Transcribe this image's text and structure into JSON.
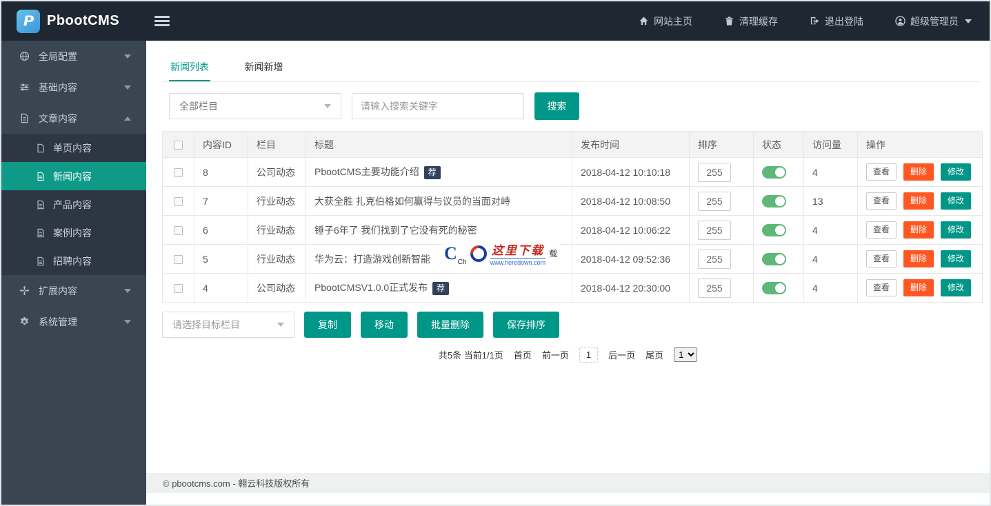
{
  "topbar": {
    "brand": "PbootCMS",
    "logo_letter": "P",
    "nav": [
      {
        "label": "网站主页",
        "icon": "home-icon"
      },
      {
        "label": "清理缓存",
        "icon": "trash-icon"
      },
      {
        "label": "退出登陆",
        "icon": "logout-icon"
      },
      {
        "label": "超级管理员",
        "icon": "user-icon"
      }
    ]
  },
  "sidebar": {
    "items": [
      {
        "label": "全局配置",
        "icon": "globe-icon",
        "state": "collapsed"
      },
      {
        "label": "基础内容",
        "icon": "sliders-icon",
        "state": "collapsed"
      },
      {
        "label": "文章内容",
        "icon": "file-text-icon",
        "state": "expanded",
        "children": [
          {
            "label": "单页内容",
            "active": false
          },
          {
            "label": "新闻内容",
            "active": true
          },
          {
            "label": "产品内容",
            "active": false
          },
          {
            "label": "案例内容",
            "active": false
          },
          {
            "label": "招聘内容",
            "active": false
          }
        ]
      },
      {
        "label": "扩展内容",
        "icon": "expand-icon",
        "state": "collapsed"
      },
      {
        "label": "系统管理",
        "icon": "gear-icon",
        "state": "collapsed"
      }
    ]
  },
  "tabs": [
    {
      "label": "新闻列表",
      "active": true
    },
    {
      "label": "新闻新增",
      "active": false
    }
  ],
  "filter": {
    "category_select": "全部栏目",
    "search_placeholder": "请输入搜索关键字",
    "search_button": "搜索"
  },
  "table": {
    "headers": [
      "内容ID",
      "栏目",
      "标题",
      "发布时间",
      "排序",
      "状态",
      "访问量",
      "操作"
    ],
    "badge": "荐",
    "actions": {
      "view": "查看",
      "delete": "删除",
      "edit": "修改"
    },
    "rows": [
      {
        "id": "8",
        "category": "公司动态",
        "title": "PbootCMS主要功能介绍",
        "recommended": true,
        "date": "2018-04-12 10:10:18",
        "sort": "255",
        "status": "on",
        "visits": "4"
      },
      {
        "id": "7",
        "category": "行业动态",
        "title": "大获全胜 扎克伯格如何赢得与议员的当面对峙",
        "recommended": false,
        "date": "2018-04-12 10:08:50",
        "sort": "255",
        "status": "on",
        "visits": "13"
      },
      {
        "id": "6",
        "category": "行业动态",
        "title": "锤子6年了 我们找到了它没有死的秘密",
        "recommended": false,
        "date": "2018-04-12 10:06:22",
        "sort": "255",
        "status": "on",
        "visits": "4"
      },
      {
        "id": "5",
        "category": "行业动态",
        "title": "华为云：打造游戏创新智能",
        "recommended": false,
        "date": "2018-04-12 09:52:36",
        "sort": "255",
        "status": "on",
        "visits": "4"
      },
      {
        "id": "4",
        "category": "公司动态",
        "title": "PbootCMSV1.0.0正式发布",
        "recommended": true,
        "date": "2018-04-12 20:30:00",
        "sort": "255",
        "status": "on",
        "visits": "4"
      }
    ]
  },
  "bulk": {
    "target_select": "请选择目标栏目",
    "copy": "复制",
    "move": "移动",
    "batch_delete": "批量删除",
    "save_sort": "保存排序"
  },
  "pagination": {
    "summary": "共5条 当前1/1页",
    "first": "首页",
    "prev": "前一页",
    "current": "1",
    "next": "后一页",
    "last": "尾页",
    "page_select": "1"
  },
  "footer": {
    "copyright": "© pbootcms.com - 翱云科技版权所有"
  },
  "watermark": {
    "brand_letter": "C",
    "sub": "Ch",
    "text": "这里下载",
    "url": "www.heredown.com",
    "suffix": "载"
  },
  "colors": {
    "accent_teal": "#009688",
    "danger_orange": "#ff5722",
    "toggle_green": "#5FB878",
    "badge_navy": "#31415a",
    "topbar_bg": "#1f2832",
    "sidebar_bg": "#3a4552",
    "submenu_bg": "#2d3643",
    "active_item_bg": "#0e9a87"
  }
}
